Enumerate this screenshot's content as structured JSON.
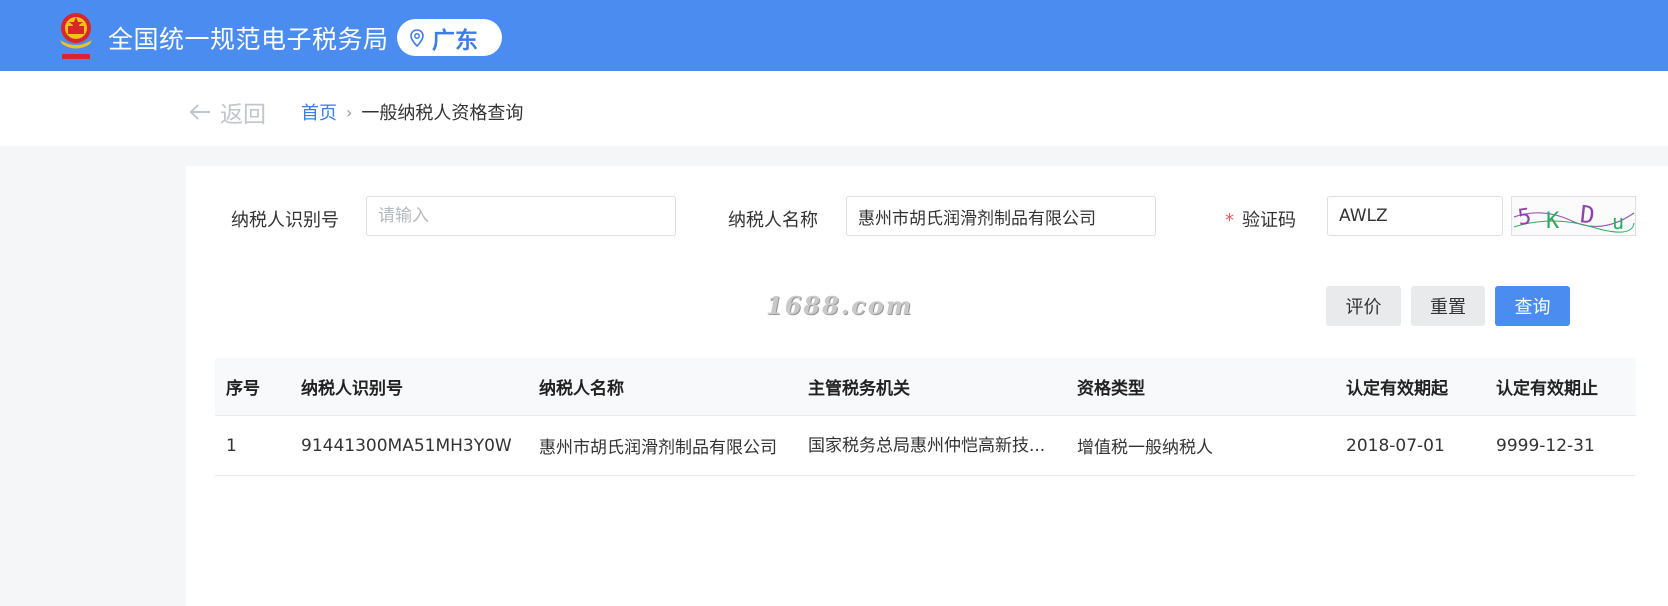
{
  "header": {
    "title": "全国统一规范电子税务局",
    "region": "广东",
    "brand_color": "#4a8cf0",
    "emblem_icon": "national-emblem-icon",
    "location_icon": "location-pin-icon"
  },
  "breadcrumb": {
    "back_label": "返回",
    "home": "首页",
    "separator": "›",
    "current": "一般纳税人资格查询"
  },
  "form": {
    "taxpayer_id_label": "纳税人识别号",
    "taxpayer_id_placeholder": "请输入",
    "taxpayer_id_value": "",
    "taxpayer_name_label": "纳税人名称",
    "taxpayer_name_value": "惠州市胡氏润滑剂制品有限公司",
    "captcha_required_mark": "*",
    "captcha_label": "验证码",
    "captcha_value": "AWLZ",
    "captcha_image_text": "5KDu"
  },
  "watermark": "1688.com",
  "actions": {
    "evaluate": "评价",
    "reset": "重置",
    "query": "查询"
  },
  "table": {
    "columns": [
      "序号",
      "纳税人识别号",
      "纳税人名称",
      "主管税务机关",
      "资格类型",
      "认定有效期起",
      "认定有效期止"
    ],
    "rows": [
      [
        "1",
        "91441300MA51MH3Y0W",
        "惠州市胡氏润滑剂制品有限公司",
        "国家税务总局惠州仲恺高新技...",
        "增值税一般纳税人",
        "2018-07-01",
        "9999-12-31"
      ]
    ]
  }
}
